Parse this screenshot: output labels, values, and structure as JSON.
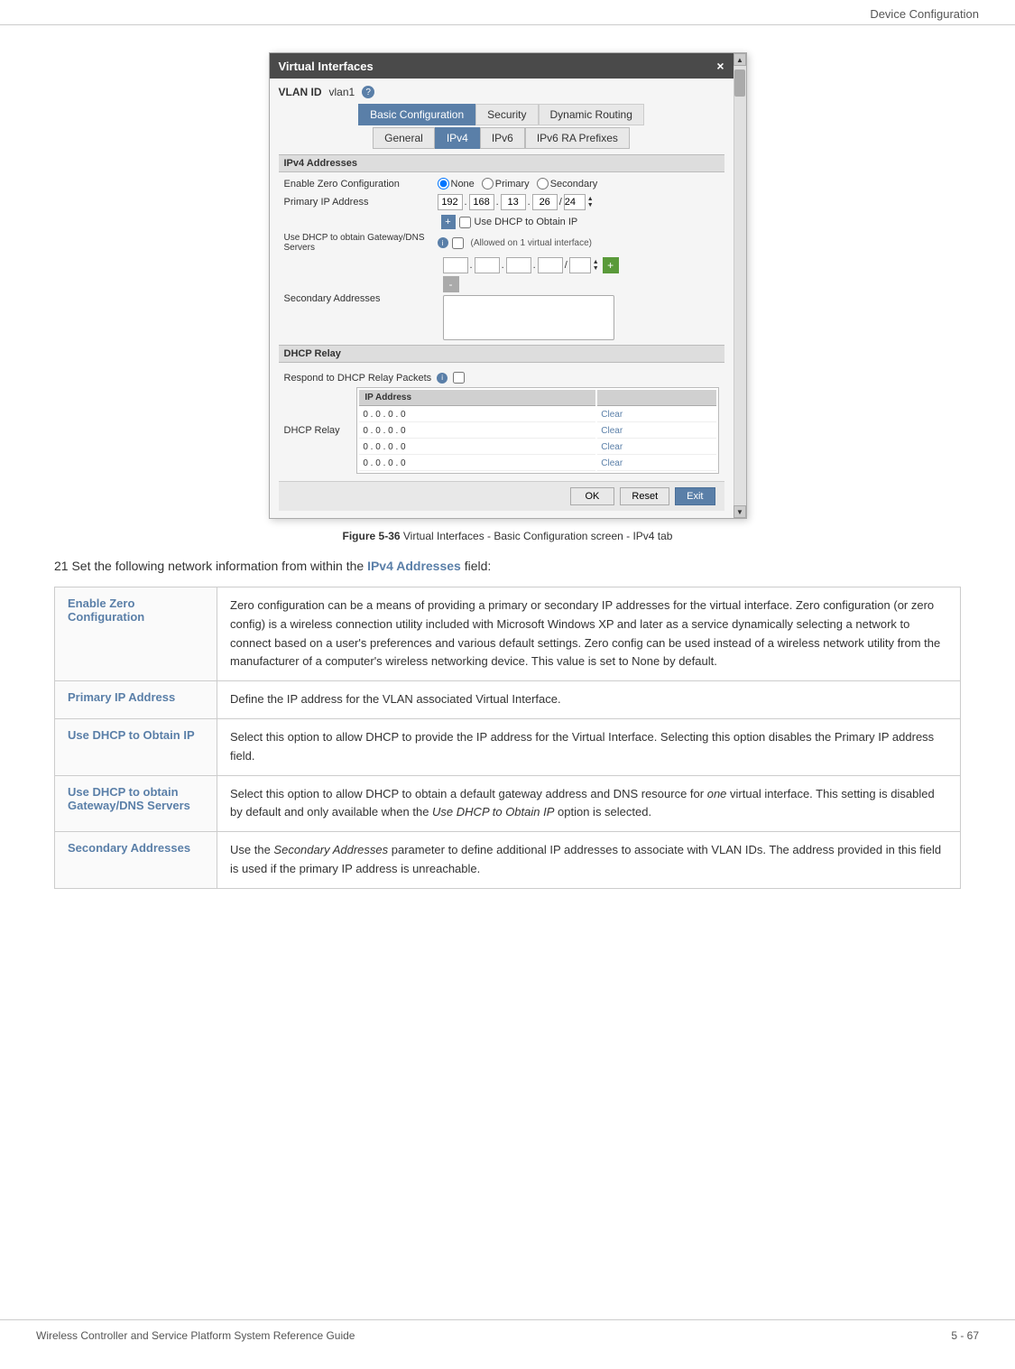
{
  "header": {
    "title": "Device Configuration"
  },
  "dialog": {
    "title": "Virtual Interfaces",
    "close_label": "×",
    "vlan_label": "VLAN ID",
    "vlan_value": "vlan1",
    "tabs_outer": [
      "Basic Configuration",
      "Security",
      "Dynamic Routing"
    ],
    "tabs_inner": [
      "General",
      "IPv4",
      "IPv6",
      "IPv6 RA Prefixes"
    ],
    "sections": {
      "ipv4": {
        "label": "IPv4 Addresses",
        "enable_zero_label": "Enable Zero Configuration",
        "radio_options": [
          "None",
          "Primary",
          "Secondary"
        ],
        "primary_ip_label": "Primary IP Address",
        "primary_ip": [
          "192",
          "168",
          "13",
          "26",
          "24"
        ],
        "use_dhcp_label": "Use DHCP to Obtain IP",
        "gateway_dns_label": "Use DHCP to obtain Gateway/DNS Servers",
        "gateway_allowed": "(Allowed on 1 virtual interface)",
        "secondary_label": "Secondary Addresses"
      },
      "dhcp_relay": {
        "label": "DHCP Relay",
        "respond_label": "Respond to DHCP Relay Packets",
        "dhcp_relay_label": "DHCP Relay",
        "table_header": "IP Address",
        "rows": [
          {
            "ip": "0 . 0 . 0 . 0",
            "action": "Clear"
          },
          {
            "ip": "0 . 0 . 0 . 0",
            "action": "Clear"
          },
          {
            "ip": "0 . 0 . 0 . 0",
            "action": "Clear"
          },
          {
            "ip": "0 . 0 . 0 . 0",
            "action": "Clear"
          }
        ]
      }
    },
    "footer": {
      "ok": "OK",
      "reset": "Reset",
      "exit": "Exit"
    }
  },
  "figure_caption": {
    "label": "Figure 5-36",
    "description": "Virtual Interfaces - Basic Configuration screen - IPv4 tab"
  },
  "description": {
    "text_before": "21  Set the following network information from within the ",
    "highlight": "IPv4 Addresses",
    "text_after": " field:"
  },
  "table": {
    "rows": [
      {
        "term": "Enable Zero Configuration",
        "definition": "Zero configuration can be a means of providing a primary or secondary IP addresses for the virtual interface. Zero configuration (or zero config) is a wireless connection utility included with Microsoft Windows XP and later as a service dynamically selecting a network to connect based on a user's preferences and various default settings. Zero config can be used instead of a wireless network utility from the manufacturer of a computer's wireless networking device. This value is set to None by default."
      },
      {
        "term": "Primary IP Address",
        "definition": "Define the IP address for the VLAN associated Virtual Interface."
      },
      {
        "term": "Use DHCP to Obtain IP",
        "definition": "Select this option to allow DHCP to provide the IP address for the Virtual Interface. Selecting this option disables the Primary IP address field."
      },
      {
        "term": "Use DHCP to obtain Gateway/DNS Servers",
        "definition": "Select this option to allow DHCP to obtain a default gateway address and DNS resource for one virtual interface. This setting is disabled by default and only available when the Use DHCP to Obtain IP option is selected."
      },
      {
        "term": "Secondary Addresses",
        "definition": "Use the Secondary Addresses parameter to define additional IP addresses to associate with VLAN IDs. The address provided in this field is used if the primary IP address is unreachable."
      }
    ]
  },
  "footer": {
    "left": "Wireless Controller and Service Platform System Reference Guide",
    "right": "5 - 67"
  }
}
